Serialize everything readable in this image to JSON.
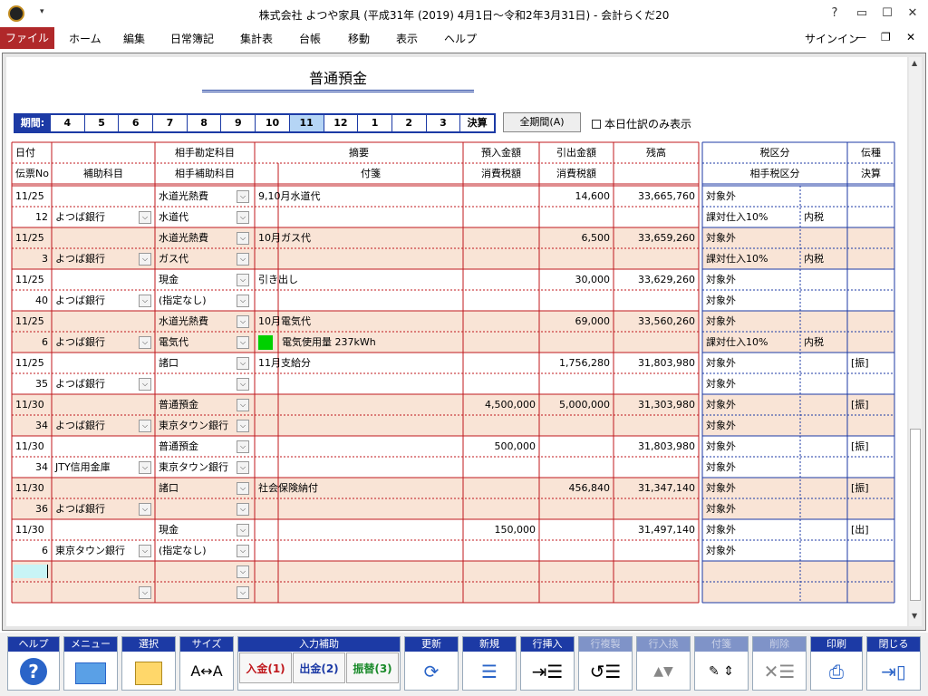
{
  "window": {
    "title": "株式会社 よつや家具 (平成31年 (2019) 4月1日～令和2年3月31日) - 会計らくだ20",
    "help": "?",
    "quick_access": "▾"
  },
  "menu": {
    "items": [
      "ファイル",
      "ホーム",
      "編集",
      "日常簿記",
      "集計表",
      "台帳",
      "移動",
      "表示",
      "ヘルプ"
    ],
    "signin": "サインイン"
  },
  "account_title": "普通預金",
  "period": {
    "label": "期間:",
    "months": [
      "4",
      "5",
      "6",
      "7",
      "8",
      "9",
      "10",
      "11",
      "12",
      "1",
      "2",
      "3",
      "決算"
    ],
    "selected": "11",
    "all_button": "全期間(A)",
    "today_only": "本日仕訳のみ表示"
  },
  "headers": {
    "date": "日付",
    "voucher_no": "伝票No",
    "sub_account": "補助科目",
    "counter_account": "相手勘定科目",
    "counter_sub": "相手補助科目",
    "summary": "摘要",
    "tag": "付箋",
    "deposit": "預入金額",
    "deposit_tax": "消費税額",
    "withdraw": "引出金額",
    "withdraw_tax": "消費税額",
    "balance": "残高",
    "tax_class": "税区分",
    "counter_tax_class": "相手税区分",
    "voucher_type": "伝種",
    "closing": "決算"
  },
  "entries": [
    {
      "date": "11/25",
      "no": "12",
      "sub": "よつば銀行",
      "acct": "水道光熱費",
      "acct_sub": "水道代",
      "desc": "9,10月水道代",
      "tag": "",
      "deposit": "",
      "withdraw": "14,600",
      "balance": "33,665,760",
      "tax": "対象外",
      "tax2": "課対仕入10%",
      "tax2b": "内税",
      "type": ""
    },
    {
      "date": "11/25",
      "no": "3",
      "sub": "よつば銀行",
      "acct": "水道光熱費",
      "acct_sub": "ガス代",
      "desc": "10月ガス代",
      "tag": "",
      "deposit": "",
      "withdraw": "6,500",
      "balance": "33,659,260",
      "tax": "対象外",
      "tax2": "課対仕入10%",
      "tax2b": "内税",
      "type": ""
    },
    {
      "date": "11/25",
      "no": "40",
      "sub": "よつば銀行",
      "acct": "現金",
      "acct_sub": "(指定なし)",
      "desc": "引き出し",
      "tag": "",
      "deposit": "",
      "withdraw": "30,000",
      "balance": "33,629,260",
      "tax": "対象外",
      "tax2": "対象外",
      "tax2b": "",
      "type": ""
    },
    {
      "date": "11/25",
      "no": "6",
      "sub": "よつば銀行",
      "acct": "水道光熱費",
      "acct_sub": "電気代",
      "desc": "10月電気代",
      "tag": "電気使用量 237kWh",
      "deposit": "",
      "withdraw": "69,000",
      "balance": "33,560,260",
      "tax": "対象外",
      "tax2": "課対仕入10%",
      "tax2b": "内税",
      "type": ""
    },
    {
      "date": "11/25",
      "no": "35",
      "sub": "よつば銀行",
      "acct": "諸口",
      "acct_sub": "",
      "desc": "11月支給分",
      "tag": "",
      "deposit": "",
      "withdraw": "1,756,280",
      "balance": "31,803,980",
      "tax": "対象外",
      "tax2": "対象外",
      "tax2b": "",
      "type": "[振]"
    },
    {
      "date": "11/30",
      "no": "34",
      "sub": "よつば銀行",
      "acct": "普通預金",
      "acct_sub": "東京タウン銀行",
      "desc": "",
      "tag": "",
      "deposit": "4,500,000",
      "withdraw": "5,000,000",
      "balance": "31,303,980",
      "tax": "対象外",
      "tax2": "対象外",
      "tax2b": "",
      "type": "[振]"
    },
    {
      "date": "11/30",
      "no": "34",
      "sub": "JTY信用金庫",
      "acct": "普通預金",
      "acct_sub": "東京タウン銀行",
      "desc": "",
      "tag": "",
      "deposit": "500,000",
      "withdraw": "",
      "balance": "31,803,980",
      "tax": "対象外",
      "tax2": "対象外",
      "tax2b": "",
      "type": "[振]"
    },
    {
      "date": "11/30",
      "no": "36",
      "sub": "よつば銀行",
      "acct": "諸口",
      "acct_sub": "",
      "desc": "社会保険納付",
      "tag": "",
      "deposit": "",
      "withdraw": "456,840",
      "balance": "31,347,140",
      "tax": "対象外",
      "tax2": "対象外",
      "tax2b": "",
      "type": "[振]"
    },
    {
      "date": "11/30",
      "no": "6",
      "sub": "東京タウン銀行",
      "acct": "現金",
      "acct_sub": "(指定なし)",
      "desc": "",
      "tag": "",
      "deposit": "150,000",
      "withdraw": "",
      "balance": "31,497,140",
      "tax": "対象外",
      "tax2": "対象外",
      "tax2b": "",
      "type": "[出]"
    }
  ],
  "toolbar": {
    "help": "ヘルプ",
    "menu": "メニュー",
    "select": "選択",
    "size": "サイズ",
    "input_assist": "入力補助",
    "deposit_btn": "入金(1)",
    "withdraw_btn": "出金(2)",
    "transfer_btn": "振替(3)",
    "update": "更新",
    "new": "新規",
    "insert_row": "行挿入",
    "copy_row": "行複製",
    "swap_row": "行入換",
    "tag": "付箋",
    "delete": "削除",
    "print": "印刷",
    "close": "閉じる"
  },
  "colors": {
    "accent_red": "#b0282a",
    "border_red": "#c0191e",
    "blue": "#1c3aa5",
    "row_alt": "#f9e4d6"
  }
}
